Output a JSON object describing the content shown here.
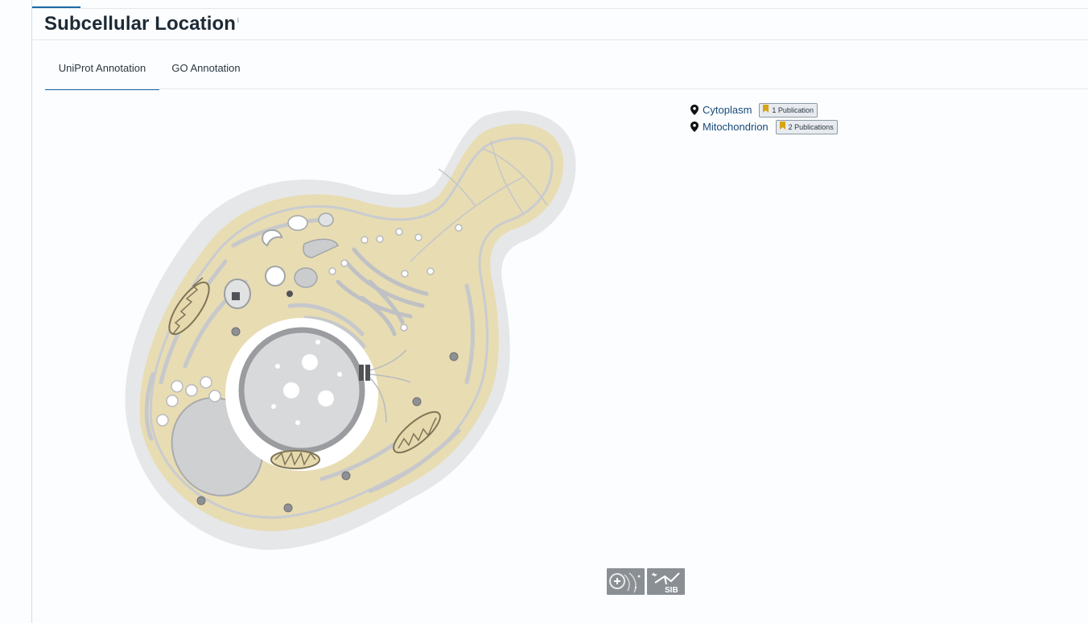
{
  "header": {
    "title": "Subcellular Location",
    "info_glyph": "i"
  },
  "tabs": [
    {
      "label": "UniProt Annotation",
      "active": true
    },
    {
      "label": "GO Annotation",
      "active": false
    }
  ],
  "locations": [
    {
      "name": "Cytoplasm",
      "publications": "1 Publication"
    },
    {
      "name": "Mitochondrion",
      "publications": "2 Publications"
    }
  ],
  "logos": {
    "right_logo_text": "SIB"
  },
  "colors": {
    "accent": "#1b6aa5",
    "link": "#1a4a7a",
    "cytoplasm_fill": "#e8dcb3",
    "membrane": "#c9ccd0",
    "bookmark": "#d6a514"
  },
  "icons": [
    "info-icon",
    "map-pin-icon",
    "bookmark-icon",
    "cell-diagram",
    "sib-logo",
    "expasy-logo"
  ]
}
